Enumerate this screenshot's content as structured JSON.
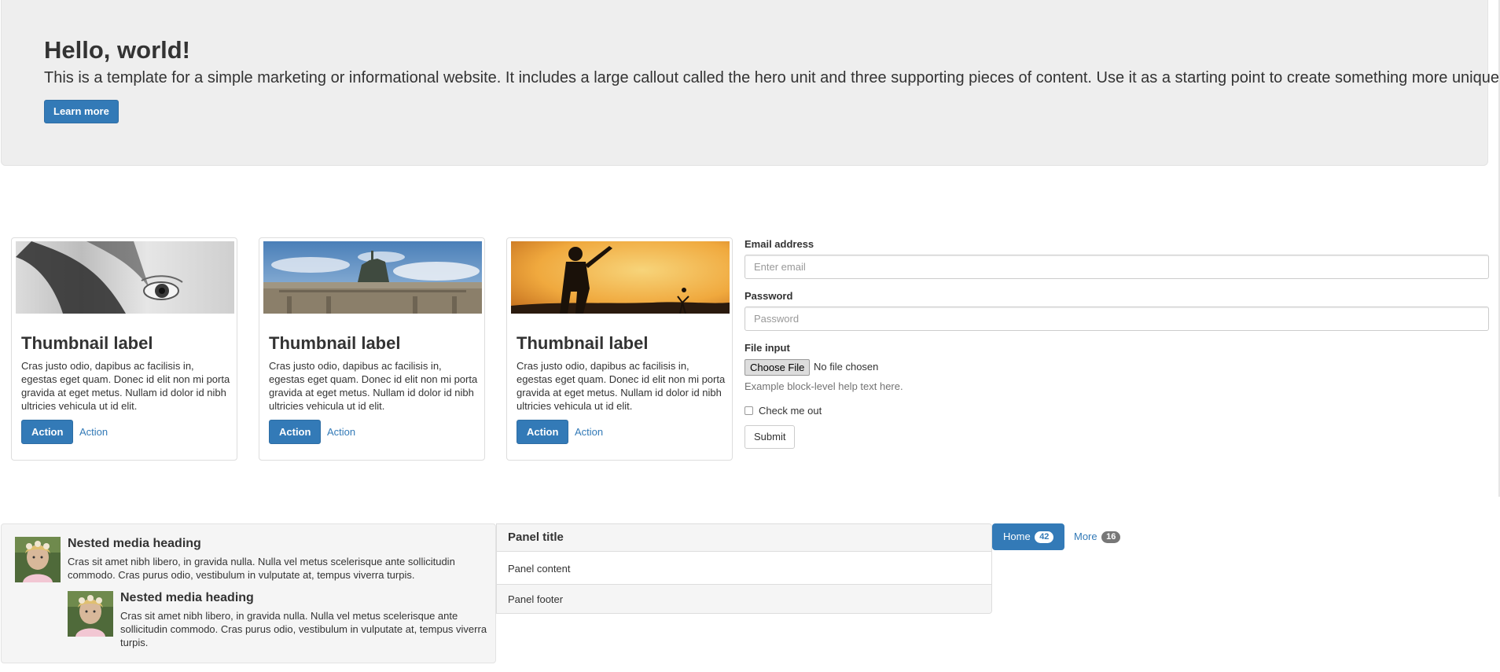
{
  "jumbotron": {
    "title": "Hello, world!",
    "lead": "This is a template for a simple marketing or informational website. It includes a large callout called the hero unit and three supporting pieces of content. Use it as a starting point to create something more unique.",
    "button": "Learn more"
  },
  "thumbnails": [
    {
      "title": "Thumbnail label",
      "text": "Cras justo odio, dapibus ac facilisis in, egestas eget quam. Donec id elit non mi porta gravida at eget metus. Nullam id dolor id nibh ultricies vehicula ut id elit.",
      "button": "Action",
      "link": "Action"
    },
    {
      "title": "Thumbnail label",
      "text": "Cras justo odio, dapibus ac facilisis in, egestas eget quam. Donec id elit non mi porta gravida at eget metus. Nullam id dolor id nibh ultricies vehicula ut id elit.",
      "button": "Action",
      "link": "Action"
    },
    {
      "title": "Thumbnail label",
      "text": "Cras justo odio, dapibus ac facilisis in, egestas eget quam. Donec id elit non mi porta gravida at eget metus. Nullam id dolor id nibh ultricies vehicula ut id elit.",
      "button": "Action",
      "link": "Action"
    }
  ],
  "form": {
    "email_label": "Email address",
    "email_placeholder": "Enter email",
    "password_label": "Password",
    "password_placeholder": "Password",
    "file_label": "File input",
    "file_button": "Choose File",
    "file_status": "No file chosen",
    "help_text": "Example block-level help text here.",
    "checkbox_label": "Check me out",
    "submit": "Submit"
  },
  "media": [
    {
      "heading": "Nested media heading",
      "text": "Cras sit amet nibh libero, in gravida nulla. Nulla vel metus scelerisque ante sollicitudin commodo. Cras purus odio, vestibulum in vulputate at, tempus viverra turpis."
    },
    {
      "heading": "Nested media heading",
      "text": "Cras sit amet nibh libero, in gravida nulla. Nulla vel metus scelerisque ante sollicitudin commodo. Cras purus odio, vestibulum in vulputate at, tempus viverra turpis."
    }
  ],
  "panel": {
    "title": "Panel title",
    "content": "Panel content",
    "footer": "Panel footer"
  },
  "pills": [
    {
      "label": "Home",
      "badge": "42",
      "active": true
    },
    {
      "label": "More",
      "badge": "16",
      "active": false
    }
  ],
  "colors": {
    "primary": "#337ab7",
    "jumbotron_bg": "#eeeeee",
    "well_bg": "#f5f5f5"
  },
  "images": {
    "thumb1": "grayscale-eye-photo",
    "thumb2": "gate-quadriga-sky-photo",
    "thumb3": "cricket-silhouette-sunset-photo",
    "media_avatar": "child-portrait-photo"
  }
}
